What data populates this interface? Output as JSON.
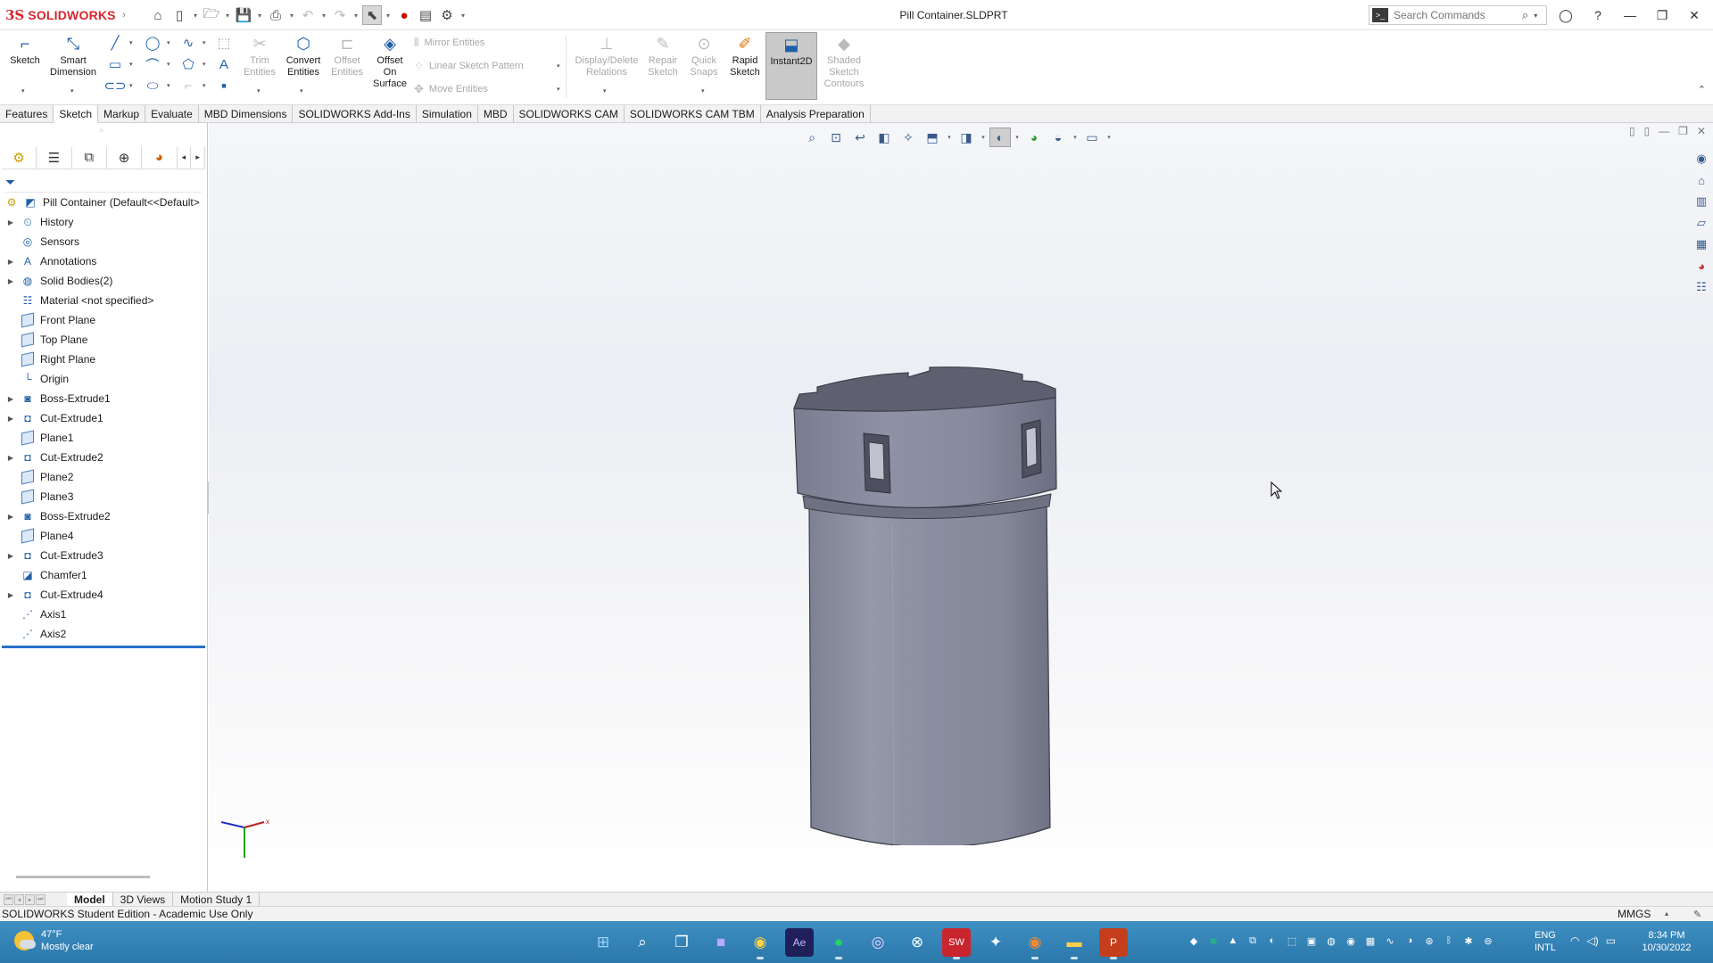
{
  "app": {
    "brand_ds": "3S",
    "brand_name": "SOLIDWORKS",
    "document_title": "Pill Container.SLDPRT",
    "search_placeholder": "Search Commands"
  },
  "ribbon": {
    "sketch": "Sketch",
    "smart_dimension_1": "Smart",
    "smart_dimension_2": "Dimension",
    "trim_1": "Trim",
    "trim_2": "Entities",
    "convert_1": "Convert",
    "convert_2": "Entities",
    "offset_1": "Offset",
    "offset_2": "Entities",
    "offset_surface_1": "Offset",
    "offset_surface_2": "On",
    "offset_surface_3": "Surface",
    "mirror": "Mirror Entities",
    "linear_pattern": "Linear Sketch Pattern",
    "move": "Move Entities",
    "display_delete_1": "Display/Delete",
    "display_delete_2": "Relations",
    "repair_1": "Repair",
    "repair_2": "Sketch",
    "quick_snaps_1": "Quick",
    "quick_snaps_2": "Snaps",
    "rapid_sketch_1": "Rapid",
    "rapid_sketch_2": "Sketch",
    "instant2d": "Instant2D",
    "shaded_1": "Shaded",
    "shaded_2": "Sketch",
    "shaded_3": "Contours"
  },
  "tabs": [
    "Features",
    "Sketch",
    "Markup",
    "Evaluate",
    "MBD Dimensions",
    "SOLIDWORKS Add-Ins",
    "Simulation",
    "MBD",
    "SOLIDWORKS CAM",
    "SOLIDWORKS CAM TBM",
    "Analysis Preparation"
  ],
  "active_tab": "Sketch",
  "tree": {
    "root": "Pill Container  (Default<<Default>",
    "items": [
      {
        "label": "History",
        "expandable": true,
        "icon": "history-icon"
      },
      {
        "label": "Sensors",
        "expandable": false,
        "icon": "sensors-icon"
      },
      {
        "label": "Annotations",
        "expandable": true,
        "icon": "annotations-icon"
      },
      {
        "label": "Solid Bodies(2)",
        "expandable": true,
        "icon": "solid-bodies-icon"
      },
      {
        "label": "Material <not specified>",
        "expandable": false,
        "icon": "material-icon"
      },
      {
        "label": "Front Plane",
        "expandable": false,
        "icon": "plane-icon"
      },
      {
        "label": "Top Plane",
        "expandable": false,
        "icon": "plane-icon"
      },
      {
        "label": "Right Plane",
        "expandable": false,
        "icon": "plane-icon"
      },
      {
        "label": "Origin",
        "expandable": false,
        "icon": "origin-icon"
      },
      {
        "label": "Boss-Extrude1",
        "expandable": true,
        "icon": "boss-extrude-icon"
      },
      {
        "label": "Cut-Extrude1",
        "expandable": true,
        "icon": "cut-extrude-icon"
      },
      {
        "label": "Plane1",
        "expandable": false,
        "icon": "plane-icon"
      },
      {
        "label": "Cut-Extrude2",
        "expandable": true,
        "icon": "cut-extrude-icon"
      },
      {
        "label": "Plane2",
        "expandable": false,
        "icon": "plane-icon"
      },
      {
        "label": "Plane3",
        "expandable": false,
        "icon": "plane-icon"
      },
      {
        "label": "Boss-Extrude2",
        "expandable": true,
        "icon": "boss-extrude-icon"
      },
      {
        "label": "Plane4",
        "expandable": false,
        "icon": "plane-icon"
      },
      {
        "label": "Cut-Extrude3",
        "expandable": true,
        "icon": "cut-extrude-icon"
      },
      {
        "label": "Chamfer1",
        "expandable": false,
        "icon": "chamfer-icon"
      },
      {
        "label": "Cut-Extrude4",
        "expandable": true,
        "icon": "cut-extrude-icon"
      },
      {
        "label": "Axis1",
        "expandable": false,
        "icon": "axis-icon"
      },
      {
        "label": "Axis2",
        "expandable": false,
        "icon": "axis-icon"
      }
    ]
  },
  "bottom_tabs": [
    "Model",
    "3D Views",
    "Motion Study 1"
  ],
  "status": {
    "left": "SOLIDWORKS Student Edition - Academic Use Only",
    "units": "MMGS"
  },
  "taskbar": {
    "temperature": "47°F",
    "weather": "Mostly clear",
    "lang_1": "ENG",
    "lang_2": "INTL",
    "time": "8:34 PM",
    "date": "10/30/2022"
  },
  "colors": {
    "accent": "#d6252d",
    "selection_blue": "#2a6fc9",
    "model_gray": "#8a8d9b",
    "taskbar": "#2f7fb3"
  }
}
